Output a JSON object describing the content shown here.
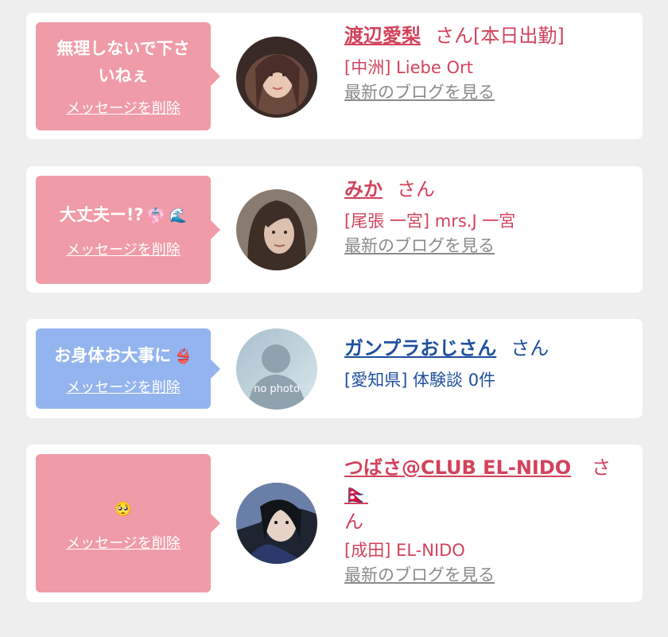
{
  "colors": {
    "page_bg": "#efeeef",
    "card_bg": "#ffffff",
    "pink_bubble": "#f09ba8",
    "blue_bubble": "#94b4ef",
    "female_name": "#d3425b",
    "male_name": "#1f4f9e",
    "blog_link": "#8a8a8a"
  },
  "cards": [
    {
      "message_line1": "無理しないで下さ",
      "message_line2": "いねぇ",
      "delete_label": "メッセージを削除",
      "name": "渡辺愛梨",
      "suffix": "さん[本日出勤]",
      "shop": "[中洲] Liebe Ort",
      "blog_link": "最新のブログを見る",
      "avatar": "profile-photo"
    },
    {
      "message": "大丈夫ー!?",
      "emoji": "👘 🌊",
      "delete_label": "メッセージを削除",
      "name": "みか",
      "suffix": "さん",
      "shop": "[尾張 一宮] mrs.J 一宮",
      "blog_link": "最新のブログを見る",
      "avatar": "profile-photo"
    },
    {
      "message": "お身体お大事に",
      "emoji": "👙",
      "delete_label": "メッセージを削除",
      "name": "ガンプラおじさん",
      "suffix": "さん",
      "shop": "[愛知県] 体験談 0件",
      "avatar": "no-photo",
      "avatar_label": "no photo"
    },
    {
      "emoji": "🥺",
      "delete_label": "メッセージを削除",
      "name": "つばさ@CLUB EL-NIDO🇳🇵",
      "suffix": "さ",
      "suffix_line2": "ん",
      "shop": "[成田] EL-NIDO",
      "blog_link": "最新のブログを見る",
      "avatar": "profile-photo"
    }
  ]
}
